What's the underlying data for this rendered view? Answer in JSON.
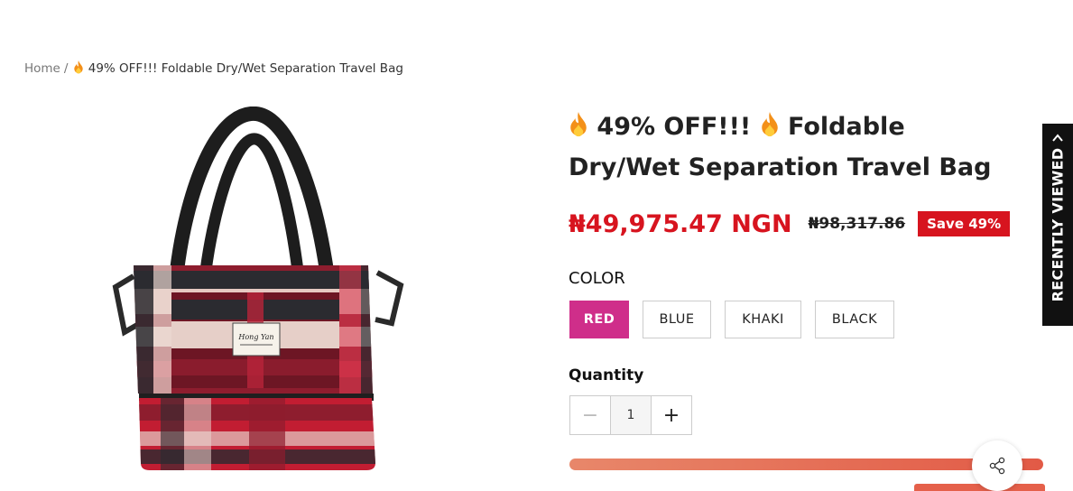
{
  "breadcrumb": {
    "home": "Home",
    "separator": "/",
    "current": "49% OFF!!! Foldable Dry/Wet Separation Travel Bag"
  },
  "product": {
    "title_part1": "49% OFF!!!",
    "title_part2": "Foldable Dry/Wet Separation Travel Bag",
    "price": "₦49,975.47 NGN",
    "compare_price": "₦98,317.86",
    "save_badge": "Save 49%"
  },
  "options": {
    "color_label": "COLOR",
    "colors": [
      "RED",
      "BLUE",
      "KHAKI",
      "BLACK"
    ],
    "selected": "RED"
  },
  "quantity": {
    "label": "Quantity",
    "value": "1",
    "minus": "−",
    "plus": "+"
  },
  "sidebar": {
    "recently_viewed": "RECENTLY VIEWED"
  },
  "icons": {
    "flame": "flame-icon",
    "share": "share-icon",
    "chevron": "chevron-up-icon"
  },
  "colors": {
    "sale_red": "#d7141f",
    "selected_swatch": "#cf2e8a",
    "button_gradient_start": "#e8876a",
    "button_gradient_end": "#e25a46"
  }
}
